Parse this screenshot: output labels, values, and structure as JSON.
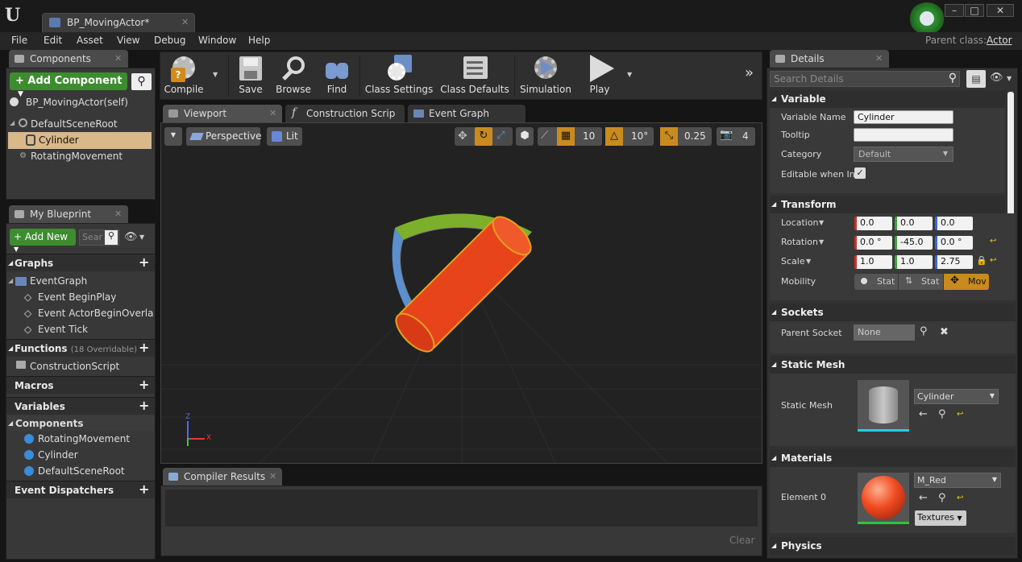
{
  "window": {
    "tab_title": "BP_MovingActor*",
    "parent_class_label": "Parent class:",
    "parent_class_value": "Actor"
  },
  "menu": [
    "File",
    "Edit",
    "Asset",
    "View",
    "Debug",
    "Window",
    "Help"
  ],
  "components_panel": {
    "tab": "Components",
    "add_button": "+ Add Component",
    "self_item": "BP_MovingActor(self)",
    "items": [
      "DefaultSceneRoot",
      "Cylinder",
      "RotatingMovement"
    ]
  },
  "my_blueprint": {
    "tab": "My Blueprint",
    "add_new": "+ Add New",
    "search_placeholder": "Sear",
    "graphs_header": "Graphs",
    "event_graph": "EventGraph",
    "events": [
      "Event BeginPlay",
      "Event ActorBeginOverla",
      "Event Tick"
    ],
    "functions_header": "Functions",
    "functions_count": "(18 Overridable)",
    "construction_script": "ConstructionScript",
    "macros_header": "Macros",
    "variables_header": "Variables",
    "components_header": "Components",
    "variable_items": [
      "RotatingMovement",
      "Cylinder",
      "DefaultSceneRoot"
    ],
    "dispatchers_header": "Event Dispatchers"
  },
  "toolbar": [
    "Compile",
    "Save",
    "Browse",
    "Find",
    "Class Settings",
    "Class Defaults",
    "Simulation",
    "Play"
  ],
  "editor_tabs": [
    "Viewport",
    "Construction Scrip",
    "Event Graph"
  ],
  "viewport": {
    "perspective": "Perspective",
    "lit": "Lit",
    "grid_snap": "10",
    "rotation_snap": "10°",
    "scale_snap": "0.25",
    "camera_speed": "4",
    "axis_x": "X",
    "axis_z": "Z"
  },
  "compiler": {
    "tab": "Compiler Results",
    "clear": "Clear"
  },
  "details": {
    "tab": "Details",
    "search_placeholder": "Search Details",
    "variable_header": "Variable",
    "variable_name_label": "Variable Name",
    "variable_name_value": "Cylinder",
    "tooltip_label": "Tooltip",
    "category_label": "Category",
    "category_value": "Default",
    "editable_label": "Editable when Inh",
    "transform_header": "Transform",
    "location_label": "Location",
    "location": [
      "0.0",
      "0.0",
      "0.0"
    ],
    "rotation_label": "Rotation",
    "rotation": [
      "0.0 °",
      "-45.0",
      "0.0 °"
    ],
    "scale_label": "Scale",
    "scale": [
      "1.0",
      "1.0",
      "2.75"
    ],
    "mobility_label": "Mobility",
    "mobility_options": [
      "Stat",
      "Stat",
      "Mov"
    ],
    "sockets_header": "Sockets",
    "parent_socket_label": "Parent Socket",
    "parent_socket_value": "None",
    "static_mesh_header": "Static Mesh",
    "static_mesh_label": "Static Mesh",
    "static_mesh_value": "Cylinder",
    "materials_header": "Materials",
    "element0_label": "Element 0",
    "material_value": "M_Red",
    "textures_label": "Textures",
    "physics_header": "Physics"
  },
  "colors": {
    "accent_orange": "#c98a1e",
    "add_green": "#3a8a2e",
    "selection": "#d9b88a"
  }
}
